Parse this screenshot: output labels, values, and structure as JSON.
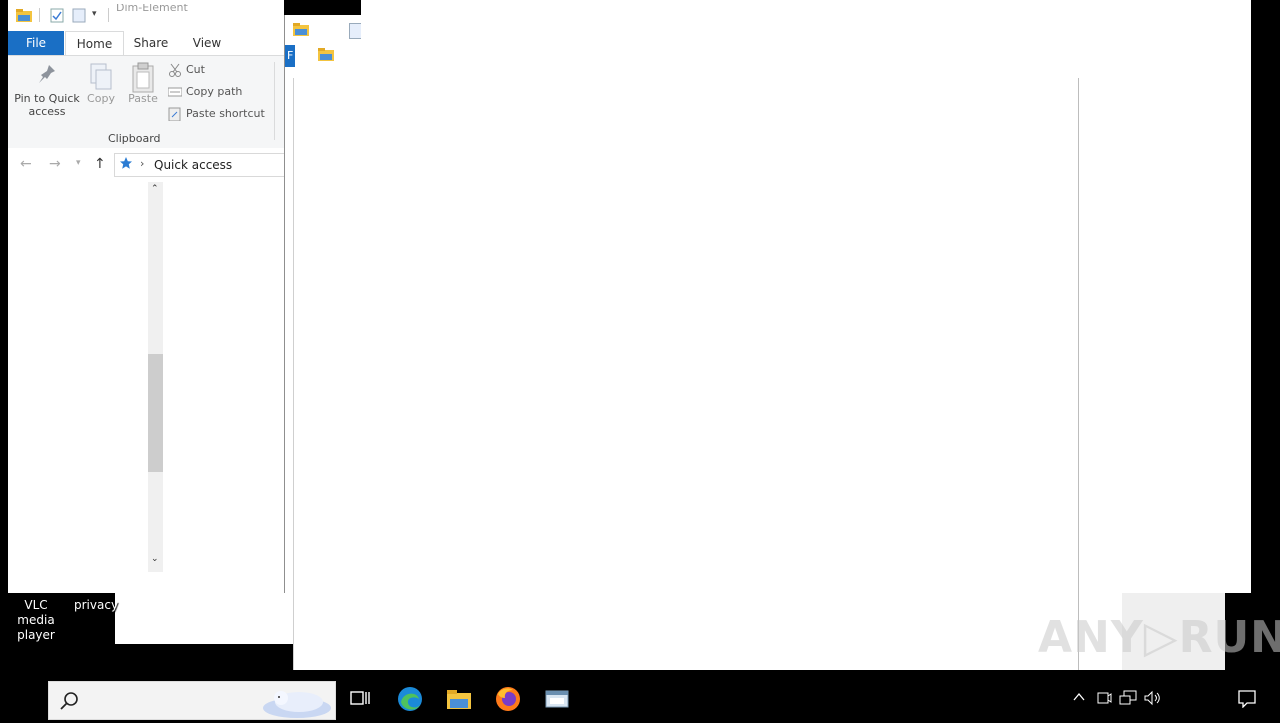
{
  "explorer": {
    "qat_title": "Dim-Element",
    "tabs": {
      "file": "File",
      "home": "Home",
      "share": "Share",
      "view": "View"
    },
    "ribbon": {
      "pin_label_line1": "Pin to Quick",
      "pin_label_line2": "access",
      "copy_label": "Copy",
      "paste_label": "Paste",
      "cut_label": "Cut",
      "copy_path_label": "Copy path",
      "paste_shortcut_label": "Paste shortcut",
      "group_label": "Clipboard"
    },
    "address": {
      "location": "Quick access",
      "separator": "›"
    }
  },
  "second_window": {
    "file_tab": "F"
  },
  "desktop": {
    "icons": [
      {
        "line1": "VLC media",
        "line2": "player"
      },
      {
        "line1": "privacy",
        "line2": ""
      }
    ]
  },
  "watermark": "ANY▷RUN",
  "icons": {
    "search": "search-icon",
    "task_view": "task-view-icon",
    "edge": "edge-icon",
    "file_explorer": "folder-icon",
    "firefox": "firefox-icon",
    "app": "app-window-icon",
    "chevron_up": "chevron-up-icon",
    "notification": "notification-icon"
  },
  "colors": {
    "accent": "#1a6fc5",
    "taskbar": "#000000"
  }
}
